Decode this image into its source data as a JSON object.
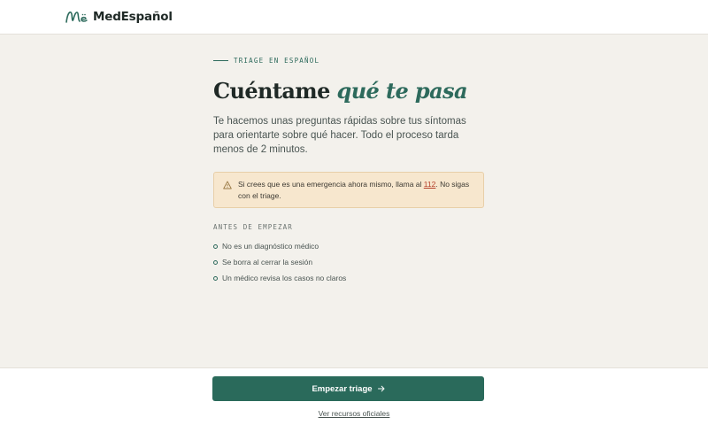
{
  "header": {
    "brand_name": "MedEspañol",
    "logo_icon": "me-monogram-logo"
  },
  "intro": {
    "eyebrow": "TRIAGE EN ESPAÑOL",
    "title_plain": "Cuéntame ",
    "title_emphasis": "qué te pasa",
    "lead": "Te hacemos unas preguntas rápidas sobre tus síntomas para orientarte sobre qué hacer. Todo el proceso tarda menos de 2 minutos."
  },
  "alert": {
    "icon": "warning-icon",
    "text_before": "Si crees que es una emergencia ahora mismo, llama al ",
    "phone": "112",
    "text_after": ". No sigas con el triage."
  },
  "before_start": {
    "label": "ANTES DE EMPEZAR",
    "items": [
      "No es un diagnóstico médico",
      "Se borra al cerrar la sesión",
      "Un médico revisa los casos no claros"
    ]
  },
  "footer": {
    "start_button": "Empezar triage",
    "start_icon": "arrow-right-icon",
    "resources_link": "Ver recursos oficiales"
  },
  "colors": {
    "accent": "#2a6a5b",
    "background": "#f3f1ec",
    "alert_background": "#f7e7ce",
    "alert_link": "#b5402a"
  }
}
